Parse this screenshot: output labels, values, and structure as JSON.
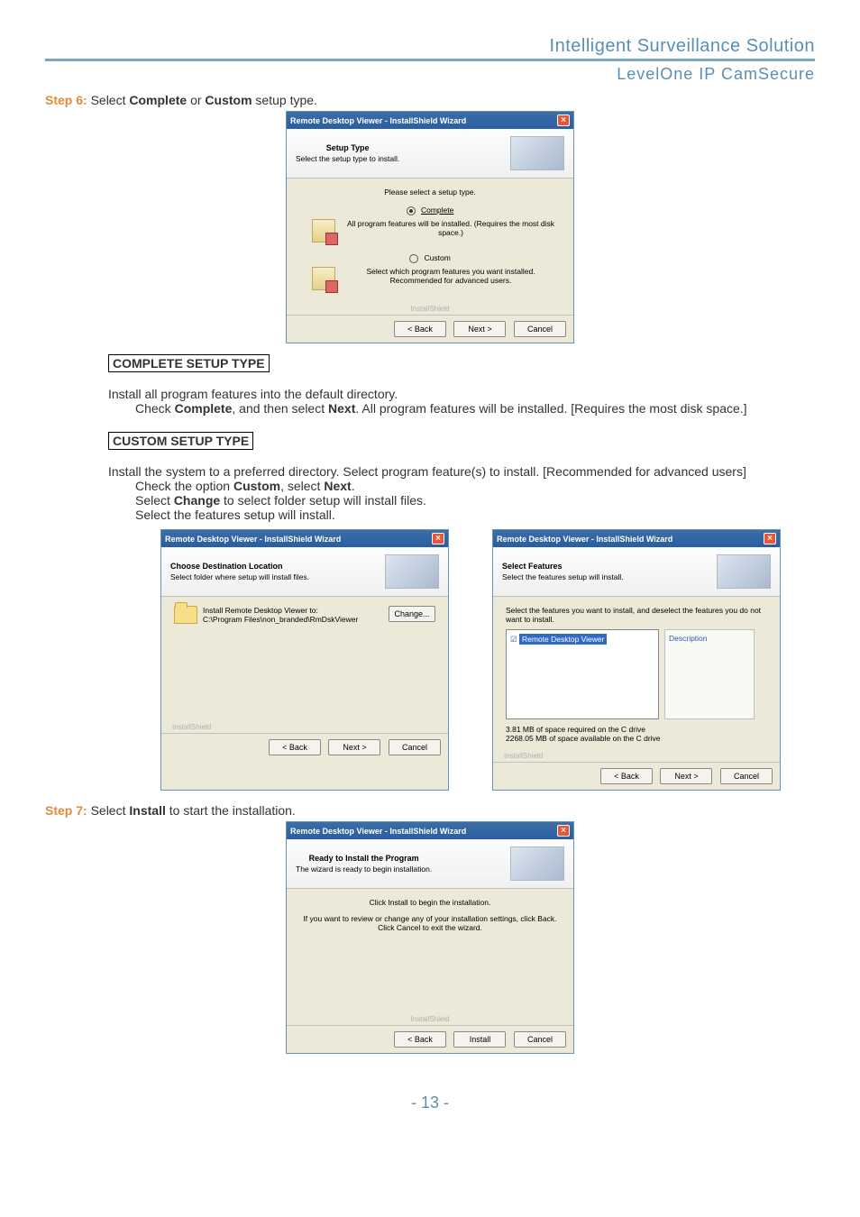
{
  "header": {
    "title": "Intelligent Surveillance Solution",
    "subtitle": "LevelOne IP CamSecure"
  },
  "step6": {
    "label": "Step 6:",
    "text_before": " Select ",
    "bold1": "Complete",
    "text_mid": " or ",
    "bold2": "Custom",
    "text_after": " setup type."
  },
  "dialog1": {
    "title": "Remote Desktop Viewer - InstallShield Wizard",
    "banner_title": "Setup Type",
    "banner_sub": "Select the setup type to install.",
    "prompt": "Please select a setup type.",
    "opt_complete": "Complete",
    "opt_complete_desc": "All program features will be installed. (Requires the most disk space.)",
    "opt_custom": "Custom",
    "opt_custom_desc": "Select which program features you want installed. Recommended for advanced users.",
    "installshield": "InstallShield",
    "btn_back": "< Back",
    "btn_next": "Next >",
    "btn_cancel": "Cancel"
  },
  "complete_section": {
    "heading": "COMPLETE SETUP TYPE",
    "line1": "Install all program features into the default directory.",
    "line2a": "Check ",
    "line2b": "Complete",
    "line2c": ", and then select ",
    "line2d": "Next",
    "line2e": ". All program features will be installed. [Requires the most disk space.]"
  },
  "custom_section": {
    "heading": "CUSTOM SETUP TYPE",
    "line1": "Install the system to a preferred directory. Select program feature(s) to install.   [Recommended for advanced users]",
    "line2a": "Check the option ",
    "line2b": "Custom",
    "line2c": ", select ",
    "line2d": "Next",
    "line2e": ".",
    "line3a": "Select ",
    "line3b": "Change",
    "line3c": " to select folder setup will install files.",
    "line4": "Select the features setup will install."
  },
  "dialog2": {
    "title": "Remote Desktop Viewer - InstallShield Wizard",
    "banner_title": "Choose Destination Location",
    "banner_sub": "Select folder where setup will install files.",
    "install_to": "Install Remote Desktop Viewer to:",
    "path": "C:\\Program Files\\non_branded\\RmDskViewer",
    "btn_change": "Change...",
    "installshield": "InstallShield",
    "btn_back": "< Back",
    "btn_next": "Next >",
    "btn_cancel": "Cancel"
  },
  "dialog3": {
    "title": "Remote Desktop Viewer - InstallShield Wizard",
    "banner_title": "Select Features",
    "banner_sub": "Select the features setup will install.",
    "prompt": "Select the features you want to install, and deselect the features you do not want to install.",
    "feature": "Remote Desktop Viewer",
    "desc_label": "Description",
    "space1": "3.81 MB of space required on the C drive",
    "space2": "2268.05 MB of space available on the C drive",
    "installshield": "InstallShield",
    "btn_back": "< Back",
    "btn_next": "Next >",
    "btn_cancel": "Cancel"
  },
  "step7": {
    "label": "Step 7:",
    "text_before": " Select ",
    "bold1": "Install",
    "text_after": " to start the installation."
  },
  "dialog4": {
    "title": "Remote Desktop Viewer - InstallShield Wizard",
    "banner_title": "Ready to Install the Program",
    "banner_sub": "The wizard is ready to begin installation.",
    "line1": "Click Install to begin the installation.",
    "line2": "If you want to review or change any of your installation settings, click Back. Click Cancel to exit the wizard.",
    "installshield": "InstallShield",
    "btn_back": "< Back",
    "btn_install": "Install",
    "btn_cancel": "Cancel"
  },
  "page_number": "- 13 -"
}
